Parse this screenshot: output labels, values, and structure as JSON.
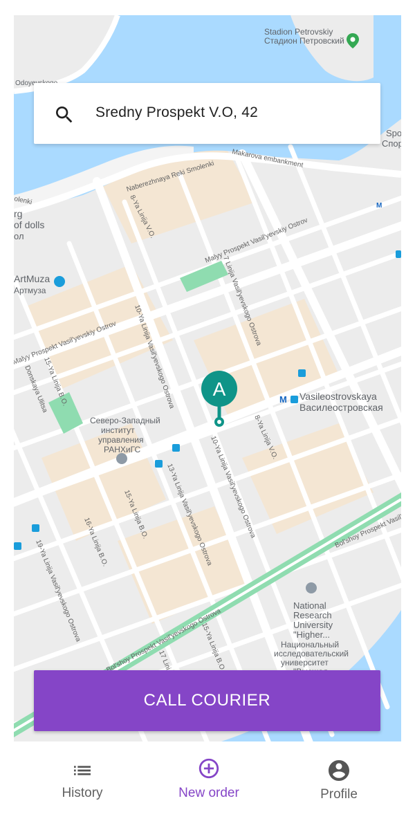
{
  "search": {
    "value": "Sredny Prospekt V.O, 42",
    "icon": "search-icon"
  },
  "map": {
    "marker_label": "A",
    "labels": {
      "stadion_en": "Stadion Petrovskiy",
      "stadion_ru": "Стадион Петровский",
      "odoyevskogo": "Odoyevskogo",
      "sport_en": "Spo",
      "sport_ru": "Спор",
      "naberezhnaya": "Naberezhnaya Reki Smolenki",
      "makarova": "Makarova embankment",
      "olenki": "olenki",
      "dolls_1": "rg",
      "dolls_2": "of dolls",
      "dolls_3": "ол",
      "linija8": "8-Ya Linija V.O.",
      "malyy": "Malyy Prospekt Vasil'yevskiy Ostrov",
      "linija7": "7 Linija Vasil'yevskogo Ostrova",
      "artmuza_en": "ArtMuza",
      "artmuza_ru": "Артмуза",
      "linija10": "10-Ya Linija Vasil'yevskogo Ostrova",
      "malyy_left": "Malyy Prospekt Vasil'yevskiy Ostrov",
      "linija15a": "15-Ya Linija B.O.",
      "donskaya": "Donskaya Ulitsa",
      "vasileostrovskaya_en": "Vasileostrovskaya",
      "vasileostrovskaya_ru": "Василеостровская",
      "institute_1": "Северо-Западный",
      "institute_2": "институт",
      "institute_3": "управления",
      "institute_4": "РАНХиГС",
      "linija8b": "8-Ya Linija V.O.",
      "linija10b": "10-Ya Linija Vasil'yevskogo Ostrova",
      "linija13": "13-Ya Linija Vasil'yevskogo Ostrova",
      "linija15b": "15-Ya Linija B.O.",
      "linija16": "16-Ya Linija B.O.",
      "linija19": "19-Ya Linija Vasil'yevskogo Ostrova",
      "bolshoy_right": "Bol'shoy Prospekt Vasil'yevskiy Ostrov",
      "bolshoy_bottom": "Bol'shoy Prospekt Vasil'yevskogo Ostrova",
      "linija15c": "15-Ya Linija B.O.",
      "linija17": "17 Lini",
      "nru_1": "National",
      "nru_2": "Research",
      "nru_3": "University",
      "nru_4": "\"Higher...",
      "nru_ru_1": "Национальный",
      "nru_ru_2": "исследовательский",
      "nru_ru_3": "университет",
      "nru_ru_4": "\"Высшая..."
    }
  },
  "actions": {
    "call_courier": "CALL COURIER"
  },
  "nav": {
    "items": [
      {
        "label": "History",
        "icon": "list-icon",
        "active": false
      },
      {
        "label": "New order",
        "icon": "add-circle-icon",
        "active": true
      },
      {
        "label": "Profile",
        "icon": "account-circle-icon",
        "active": false
      }
    ]
  },
  "colors": {
    "accent": "#8545c7",
    "marker": "#0f9488",
    "water": "#aadaff",
    "park": "#8fdcb0",
    "nav_inactive": "#616161"
  }
}
